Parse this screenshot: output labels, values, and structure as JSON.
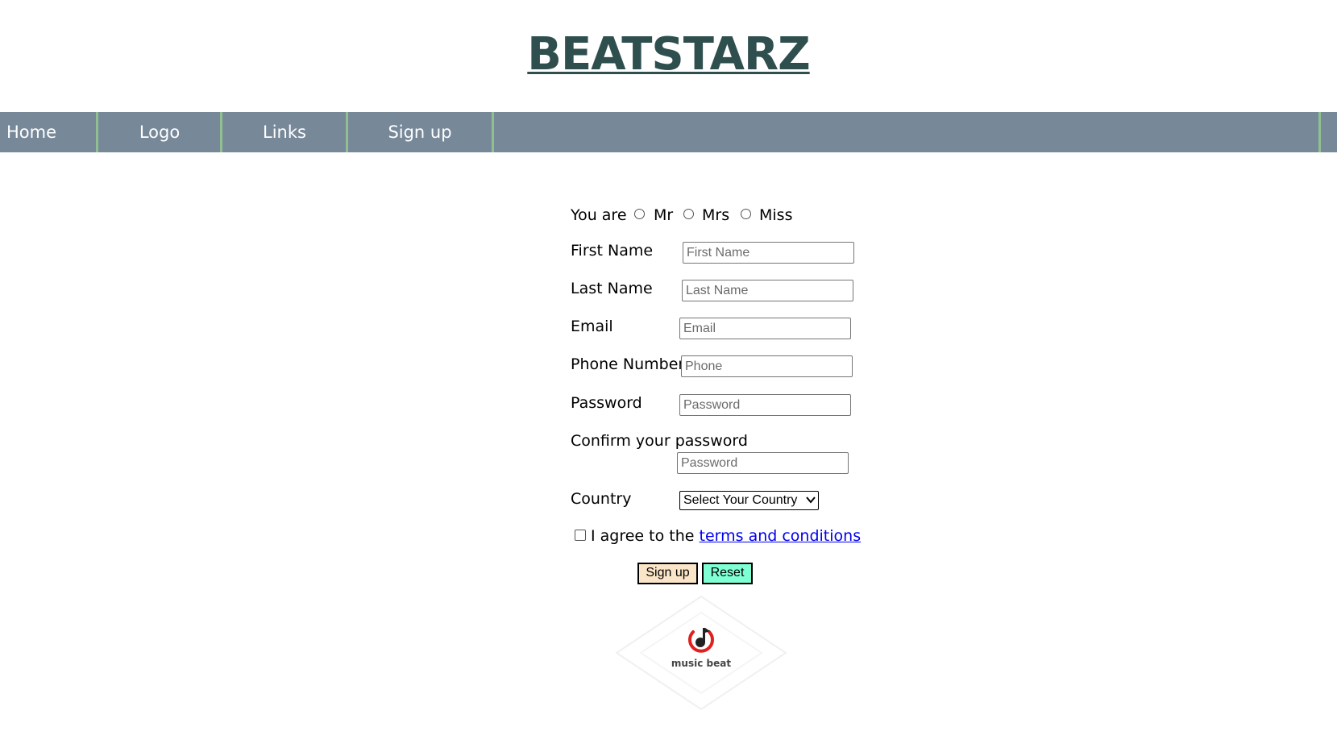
{
  "header": {
    "title": "BEATSTARZ"
  },
  "nav": {
    "items": [
      {
        "label": "Home"
      },
      {
        "label": "Logo"
      },
      {
        "label": "Links"
      },
      {
        "label": "Sign up"
      }
    ]
  },
  "form": {
    "salutation": {
      "label": "You are",
      "options": [
        "Mr",
        "Mrs",
        "Miss"
      ]
    },
    "first_name": {
      "label": "First Name",
      "placeholder": "First Name",
      "value": ""
    },
    "last_name": {
      "label": "Last Name",
      "placeholder": "Last Name",
      "value": ""
    },
    "email": {
      "label": "Email",
      "placeholder": "Email",
      "value": ""
    },
    "phone": {
      "label": "Phone Number",
      "placeholder": "Phone",
      "value": ""
    },
    "password": {
      "label": "Password",
      "placeholder": "Password",
      "value": ""
    },
    "confirm_password": {
      "label": "Confirm your password",
      "placeholder": "Password",
      "value": ""
    },
    "country": {
      "label": "Country",
      "selected": "Select Your Country"
    },
    "terms": {
      "prefix": "I agree to the ",
      "link_text": "terms and conditions",
      "checked": false
    },
    "buttons": {
      "submit_label": "Sign up",
      "reset_label": "Reset",
      "submit_color": "#fbe5c8",
      "reset_color": "#7fffd4"
    }
  },
  "logo": {
    "caption": "music beat",
    "accent_color": "#e02020",
    "icon": "music-note-icon"
  },
  "colors": {
    "title": "#2f4f4f",
    "nav_bg": "#778899",
    "nav_separator": "#90c090",
    "link": "#0000ee"
  }
}
